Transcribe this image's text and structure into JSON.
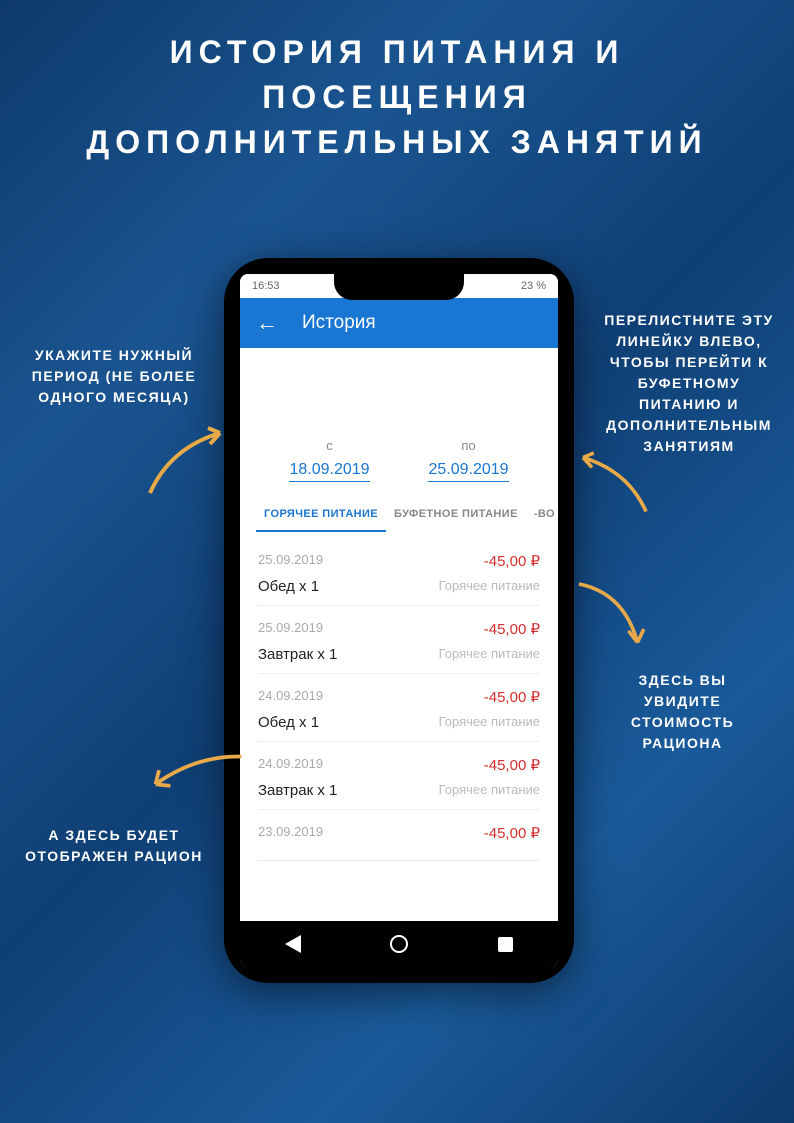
{
  "title_line1": "ИСТОРИЯ ПИТАНИЯ И",
  "title_line2": "ПОСЕЩЕНИЯ",
  "title_line3": "ДОПОЛНИТЕЛЬНЫХ ЗАНЯТИЙ",
  "status": {
    "time": "16:53",
    "battery": "23 %"
  },
  "header": {
    "title": "История"
  },
  "date_from_label": "с",
  "date_from": "18.09.2019",
  "date_to_label": "по",
  "date_to": "25.09.2019",
  "tabs": {
    "hot": "ГОРЯЧЕЕ ПИТАНИЕ",
    "buffet": "БУФЕТНОЕ ПИТАНИЕ",
    "extra": "-ВО"
  },
  "items": [
    {
      "date": "25.09.2019",
      "price": "-45,00 ₽",
      "name": "Обед х 1",
      "cat": "Горячее питание"
    },
    {
      "date": "25.09.2019",
      "price": "-45,00 ₽",
      "name": "Завтрак х 1",
      "cat": "Горячее питание"
    },
    {
      "date": "24.09.2019",
      "price": "-45,00 ₽",
      "name": "Обед х 1",
      "cat": "Горячее питание"
    },
    {
      "date": "24.09.2019",
      "price": "-45,00 ₽",
      "name": "Завтрак х 1",
      "cat": "Горячее питание"
    },
    {
      "date": "23.09.2019",
      "price": "-45,00 ₽",
      "name": "",
      "cat": ""
    }
  ],
  "callouts": {
    "c1": "УКАЖИТЕ НУЖНЫЙ ПЕРИОД (НЕ БОЛЕЕ ОДНОГО МЕСЯЦА)",
    "c2": "ПЕРЕЛИСТНИТЕ ЭТУ ЛИНЕЙКУ ВЛЕВО, ЧТОБЫ ПЕРЕЙТИ К БУФЕТНОМУ ПИТАНИЮ И ДОПОЛНИТЕЛЬНЫМ ЗАНЯТИЯМ",
    "c3": "ЗДЕСЬ ВЫ УВИДИТЕ СТОИМОСТЬ РАЦИОНА",
    "c4": "А ЗДЕСЬ БУДЕТ ОТОБРАЖЕН РАЦИОН"
  }
}
